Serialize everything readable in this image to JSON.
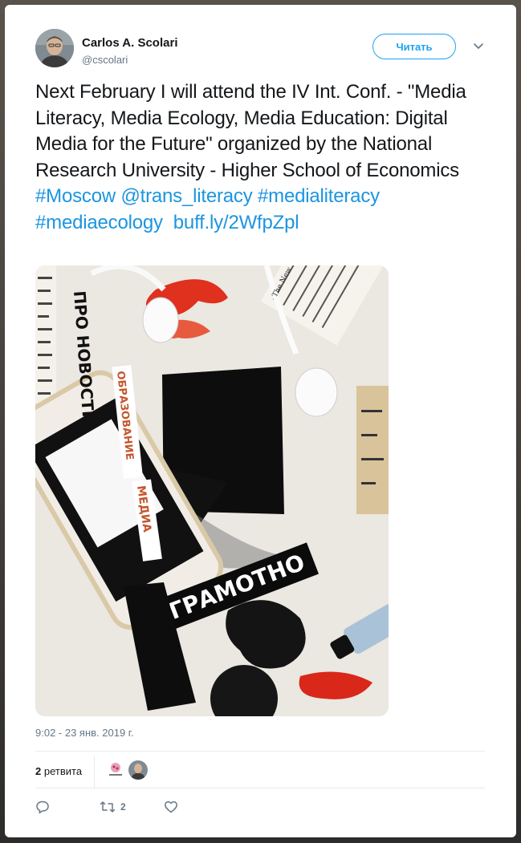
{
  "tweet": {
    "author": {
      "name": "Carlos A. Scolari",
      "handle": "@cscolari"
    },
    "follow_label": "Читать",
    "text_plain": "Next February I will attend the IV Int. Conf. - \"Media Literacy, Media Ecology, Media Education: Digital Media for the Future\" organized by the National Research University - Higher School of Economics",
    "links": {
      "hashtag_moscow": "#Moscow",
      "mention_trans_literacy": "@trans_literacy",
      "hashtag_medialiteracy": "#medialiteracy",
      "hashtag_mediaecology": "#mediaecology",
      "short_url": "buff.ly/2WfpZpl"
    },
    "media": {
      "collage_words": {
        "pro_novosti": "ПРО НОВОСТИ",
        "obrazovanie": "ОБРАЗОВАНИЕ",
        "media": "МЕДИА",
        "gramotno": "ГРАМОТНО",
        "newspaper": "The New York Times"
      }
    },
    "timestamp": "9:02 - 23 янв. 2019 г.",
    "stats": {
      "retweets_count": "2",
      "retweets_label": "ретвита"
    },
    "actions": {
      "reply_count": "",
      "retweet_count": "2",
      "like_count": ""
    }
  },
  "colors": {
    "link": "#1b95e0",
    "text": "#14171a",
    "muted": "#657786",
    "accent": "#1da1f2"
  },
  "icons": {
    "caret": "chevron-down-icon",
    "reply": "reply-icon",
    "retweet": "retweet-icon",
    "like": "heart-icon"
  }
}
